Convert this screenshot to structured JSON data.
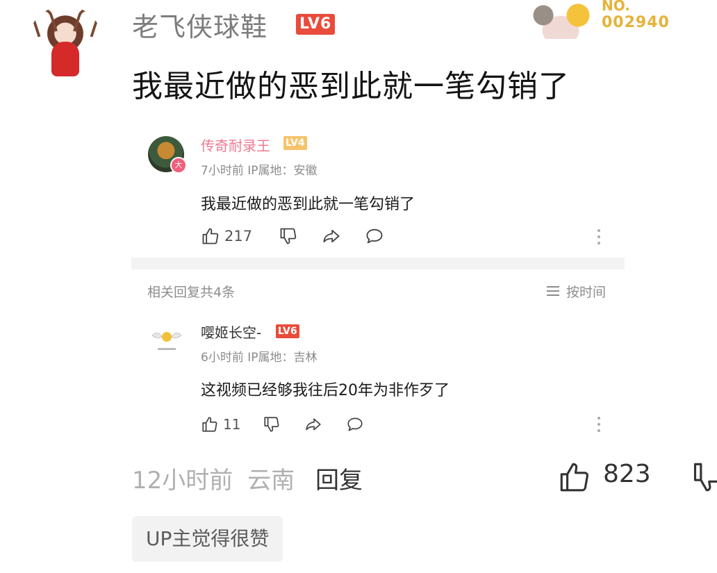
{
  "top_comment": {
    "username": "老飞侠球鞋",
    "level": "LV6",
    "fan_badge": {
      "prefix": "NO.",
      "number": "002940"
    },
    "content": "我最近做的恶到此就一笔勾销了",
    "time": "12小时前",
    "location": "云南",
    "reply_label": "回复",
    "like_count": "823",
    "tag": "UP主觉得很赞"
  },
  "quoted_comment": {
    "username": "传奇耐录王",
    "level": "LV4",
    "meta": "7小时前 IP属地：安徽",
    "content": "我最近做的恶到此就一笔勾销了",
    "like_count": "217",
    "vip_badge": "大"
  },
  "related": {
    "label": "相关回复共4条",
    "sort_label": "按时间"
  },
  "reply": {
    "username": "嘤姬长空-",
    "level": "LV6",
    "meta": "6小时前 IP属地：吉林",
    "content": "这视频已经够我往后20年为非作歹了",
    "like_count": "11"
  },
  "colors": {
    "level_red": "#e94b3c",
    "level_gold": "#f6c36b",
    "vip_pink": "#ee7a93",
    "badge_gold": "#e6b339"
  },
  "icons": [
    "thumbs-up-icon",
    "thumbs-down-icon",
    "share-icon",
    "comment-icon",
    "more-vertical-icon",
    "sort-list-icon"
  ]
}
